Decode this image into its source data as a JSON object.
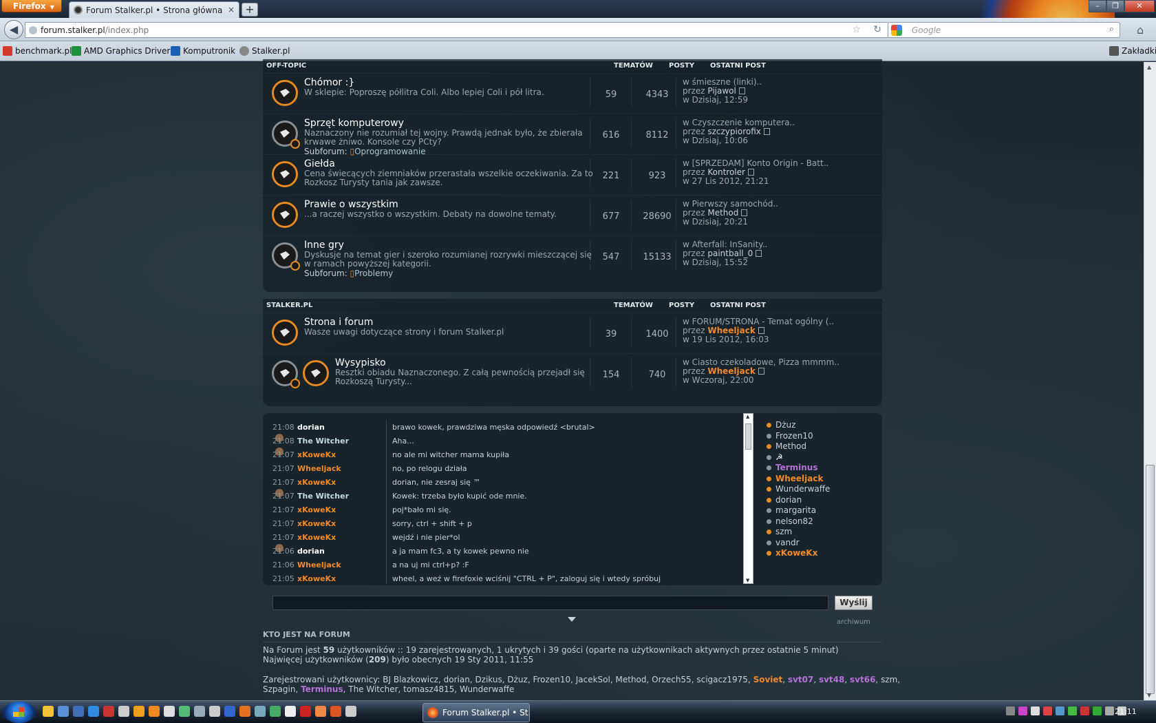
{
  "browser": {
    "app_button": "Firefox",
    "tab_title": "Forum Stalker.pl • Strona główna",
    "url_host": "forum.stalker.pl",
    "url_path": "/index.php",
    "url_prefix": "",
    "search_placeholder": "Google",
    "new_tab": "+",
    "bookmarks": [
      {
        "label": "benchmark.pl",
        "color": "#d23a2a"
      },
      {
        "label": "AMD Graphics Drivers",
        "color": "#1b8f3a"
      },
      {
        "label": "Komputronik",
        "color": "#1d5fb5"
      },
      {
        "label": "Stalker.pl",
        "color": "#888888"
      }
    ],
    "bookmarks_menu": "Zakładki"
  },
  "sections": [
    {
      "name": "OFF-TOPIC",
      "col_topics": "TEMATÓW",
      "col_posts": "POSTY",
      "col_last": "OSTATNI POST",
      "forums": [
        {
          "title": "Chómor :}",
          "desc": "W sklepie: Poproszę półlitra Coli. Albo lepiej Coli i pół litra.",
          "subforum": null,
          "topics": "59",
          "posts": "4343",
          "last_topic": "w śmieszne (linki)..",
          "last_by_prefix": "przez ",
          "last_by": "Pijawol",
          "last_date": "w Dzisiaj, 12:59"
        },
        {
          "title": "Sprzęt komputerowy",
          "desc": "Naznaczony nie rozumiał tej wojny. Prawdą jednak było, że zbierała krwawe żniwo. Konsole czy PCty?",
          "subforum": "Oprogramowanie",
          "topics": "616",
          "posts": "8112",
          "last_topic": "w Czyszczenie komputera..",
          "last_by_prefix": "przez ",
          "last_by": "szczypiorofix",
          "last_date": "w Dzisiaj, 10:06"
        },
        {
          "title": "Giełda",
          "desc": "Cena świecących ziemniaków przerastała wszelkie oczekiwania. Za to Rozkosz Turysty tania jak zawsze.",
          "subforum": null,
          "topics": "221",
          "posts": "923",
          "last_topic": "w [SPRZEDAM] Konto Origin - Batt..",
          "last_by_prefix": "przez ",
          "last_by": "Kontroler",
          "last_date": "w 27 Lis 2012, 21:21"
        },
        {
          "title": "Prawie o wszystkim",
          "desc": "...a raczej wszystko o wszystkim. Debaty na dowolne tematy.",
          "subforum": null,
          "topics": "677",
          "posts": "28690",
          "last_topic": "w Pierwszy samochód..",
          "last_by_prefix": "przez ",
          "last_by": "Method",
          "last_date": "w Dzisiaj, 20:21"
        },
        {
          "title": "Inne gry",
          "desc": "Dyskusje na temat gier i szeroko rozumianej rozrywki mieszczącej się w ramach powyższej kategorii.",
          "subforum": "Problemy",
          "topics": "547",
          "posts": "15133",
          "last_topic": "w Afterfall: InSanity..",
          "last_by_prefix": "przez ",
          "last_by": "paintball_0",
          "last_date": "w Dzisiaj, 15:52"
        }
      ]
    },
    {
      "name": "STALKER.PL",
      "col_topics": "TEMATÓW",
      "col_posts": "POSTY",
      "col_last": "OSTATNI POST",
      "forums": [
        {
          "title": "Strona i forum",
          "desc": "Wasze uwagi dotyczące strony i forum Stalker.pl",
          "subforum": null,
          "topics": "39",
          "posts": "1400",
          "last_topic": "w FORUM/STRONA - Temat ogólny (..",
          "last_by_prefix": "przez ",
          "last_by": "Wheeljack",
          "last_date": "w 19 Lis 2012, 16:03"
        },
        {
          "title": "Wysypisko",
          "desc": "Resztki obiadu Naznaczonego. Z całą pewnością przejadł się Rozkoszą Turysty...",
          "subforum": null,
          "topics": "154",
          "posts": "740",
          "last_topic": "w Ciasto czekoladowe, Pizza mmmm..",
          "last_by_prefix": "przez ",
          "last_by": "Wheeljack",
          "last_date": "w Wczoraj, 22:00"
        }
      ]
    }
  ],
  "subforum_label": "Subforum:",
  "shoutbox": {
    "messages": [
      {
        "time": "21:08",
        "user": "dorian",
        "color": "#ffffff",
        "text": "brawo kowek, prawdziwa męska odpowiedź <brutal>"
      },
      {
        "time": "21:08",
        "user": "The Witcher",
        "color": "#c5dde8",
        "text": "Aha..."
      },
      {
        "time": "21:07",
        "user": "xKoweKx",
        "color": "#f08a2a",
        "text": "no ale mi witcher mama kupiła"
      },
      {
        "time": "21:07",
        "user": "Wheeljack",
        "color": "#f08a2a",
        "text": "no, po relogu działa"
      },
      {
        "time": "21:07",
        "user": "xKoweKx",
        "color": "#f08a2a",
        "text": "dorian, nie zesraj się ™"
      },
      {
        "time": "21:07",
        "user": "The Witcher",
        "color": "#c5dde8",
        "text": "Kowek: trzeba było kupić ode mnie."
      },
      {
        "time": "21:07",
        "user": "xKoweKx",
        "color": "#f08a2a",
        "text": "poj*bało mi się."
      },
      {
        "time": "21:07",
        "user": "xKoweKx",
        "color": "#f08a2a",
        "text": "sorry, ctrl + shift + p"
      },
      {
        "time": "21:07",
        "user": "xKoweKx",
        "color": "#f08a2a",
        "text": "wejdź i nie pier*ol"
      },
      {
        "time": "21:06",
        "user": "dorian",
        "color": "#ffffff",
        "text": "a ja mam fc3, a ty kowek pewno nie"
      },
      {
        "time": "21:06",
        "user": "Wheeljack",
        "color": "#f08a2a",
        "text": "a na uj mi ctrl+p? :F"
      },
      {
        "time": "21:05",
        "user": "xKoweKx",
        "color": "#f08a2a",
        "text": "wheel, a weź w firefoxie wciśnij \"CTRL + P\", zaloguj się i wtedy spróbuj"
      }
    ],
    "online": [
      {
        "name": "Dżuz",
        "color": "#c8d0d8",
        "dot": "orange"
      },
      {
        "name": "Frozen10",
        "color": "#c8d0d8",
        "dot": "grey"
      },
      {
        "name": "Method",
        "color": "#c8d0d8",
        "dot": "orange"
      },
      {
        "name": "☭",
        "color": "#ffffff",
        "dot": "grey"
      },
      {
        "name": "Terminus",
        "color": "#b572d8",
        "dot": "grey"
      },
      {
        "name": "Wheeljack",
        "color": "#f08a2a",
        "dot": "orange"
      },
      {
        "name": "Wunderwaffe",
        "color": "#c8d0d8",
        "dot": "orange"
      },
      {
        "name": "dorian",
        "color": "#c8d0d8",
        "dot": "orange"
      },
      {
        "name": "margarita",
        "color": "#c8d0d8",
        "dot": "grey"
      },
      {
        "name": "nelson82",
        "color": "#c8d0d8",
        "dot": "grey"
      },
      {
        "name": "szm",
        "color": "#c8d0d8",
        "dot": "orange"
      },
      {
        "name": "vandr",
        "color": "#c8d0d8",
        "dot": "grey"
      },
      {
        "name": "xKoweKx",
        "color": "#f08a2a",
        "dot": "orange"
      }
    ],
    "send_label": "Wyślij",
    "archive_label": "archiwum"
  },
  "who": {
    "heading": "KTO JEST NA FORUM",
    "line1_a": "Na Forum jest ",
    "line1_count": "59",
    "line1_b": " użytkowników :: 19 zarejestrowanych, 1 ukrytych i 39 gości (oparte na użytkownikach aktywnych przez ostatnie 5 minut)",
    "line2_a": "Najwięcej użytkowników (",
    "line2_count": "209",
    "line2_b": ") było obecnych 19 Sty 2011, 11:55",
    "reg_prefix": "Zarejestrowani użytkownicy: ",
    "reg_users_line1": [
      {
        "name": "BJ Blazkowicz",
        "style": "n"
      },
      {
        "name": "dorian",
        "style": "n"
      },
      {
        "name": "Dzikus",
        "style": "n"
      },
      {
        "name": "Dżuz",
        "style": "n"
      },
      {
        "name": "Frozen10",
        "style": "n"
      },
      {
        "name": "JacekSol",
        "style": "n"
      },
      {
        "name": "Method",
        "style": "n"
      },
      {
        "name": "Orzech55",
        "style": "n"
      },
      {
        "name": "scigacz1975",
        "style": "n"
      },
      {
        "name": "Soviet",
        "style": "or"
      },
      {
        "name": "svt07",
        "style": "pu"
      },
      {
        "name": "svt48",
        "style": "pu"
      },
      {
        "name": "svt66",
        "style": "pu"
      },
      {
        "name": "szm",
        "style": "n"
      }
    ],
    "reg_users_line2": [
      {
        "name": "Szpagin",
        "style": "n"
      },
      {
        "name": "Terminus",
        "style": "pu"
      },
      {
        "name": "The Witcher",
        "style": "n"
      },
      {
        "name": "tomasz4815",
        "style": "n"
      },
      {
        "name": "Wunderwaffe",
        "style": "n"
      }
    ]
  },
  "taskbar": {
    "task_label": "Forum Stalker.pl • St...",
    "clock": "21:11"
  }
}
